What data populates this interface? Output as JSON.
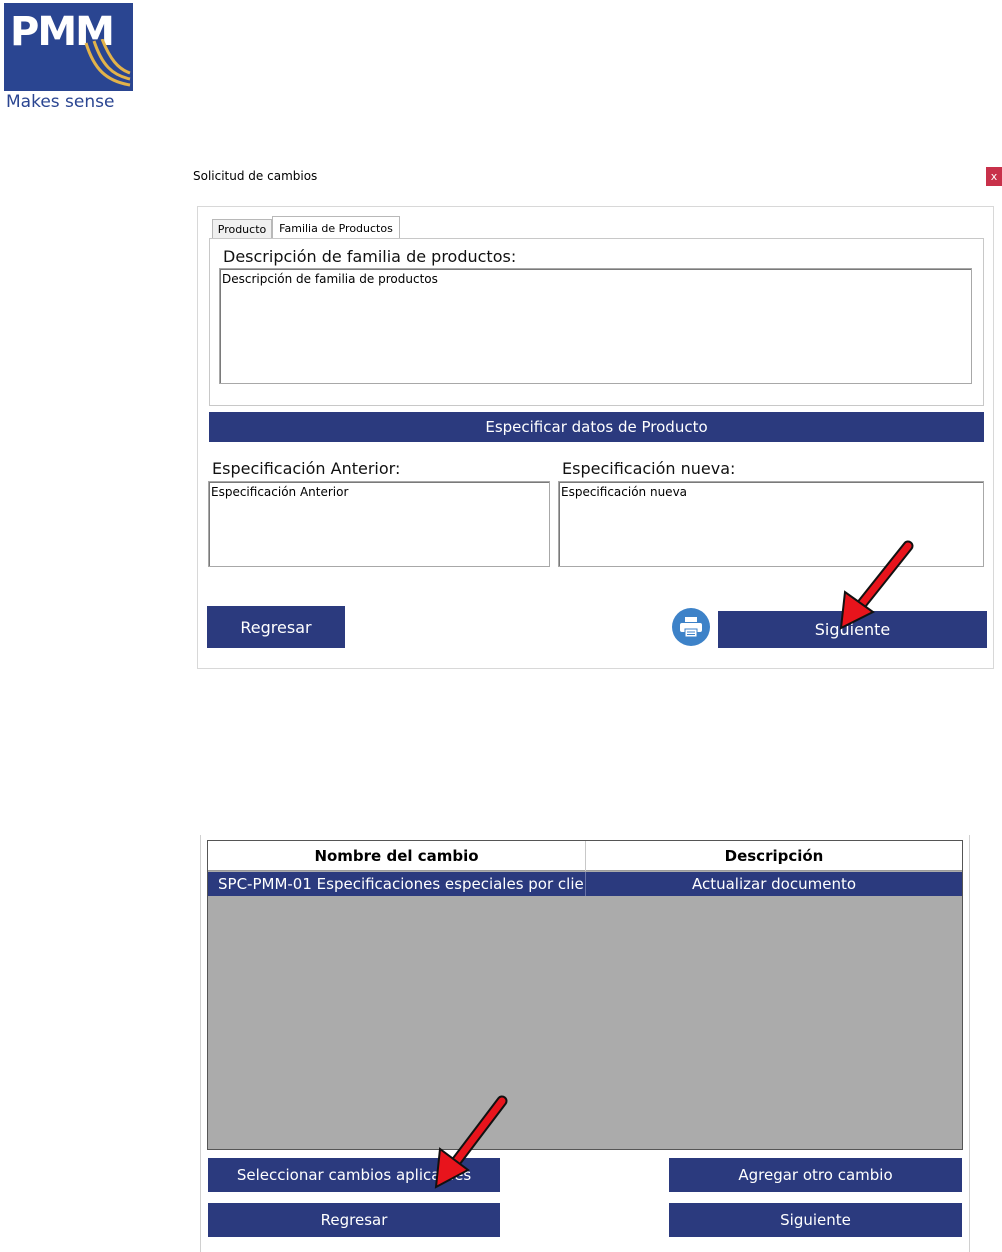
{
  "logo": {
    "brand": "PMM",
    "tagline": "Makes sense"
  },
  "dialog": {
    "title": "Solicitud de cambios",
    "close_label": "x",
    "tabs": [
      {
        "label": "Producto"
      },
      {
        "label": "Familia de Productos"
      }
    ],
    "family_desc_label": "Descripción de familia de productos:",
    "family_desc_value": "Descripción de familia de productos",
    "spec_button_label": "Especificar datos de Producto",
    "prev_spec_label": "Especificación Anterior:",
    "prev_spec_value": "Especificación Anterior",
    "new_spec_label": "Especificación nueva:",
    "new_spec_value": "Especificación nueva",
    "back_button_label": "Regresar",
    "print_icon": "printer-icon",
    "next_button_label": "Siguiente"
  },
  "changes": {
    "columns": [
      "Nombre del cambio",
      "Descripción"
    ],
    "rows": [
      {
        "name": "SPC-PMM-01 Especificaciones especiales por clie...",
        "description": "Actualizar documento"
      }
    ],
    "select_button_label": "Seleccionar cambios aplicables",
    "add_button_label": "Agregar otro cambio",
    "back_button_label": "Regresar",
    "next_button_label": "Siguiente"
  },
  "colors": {
    "accent": "#2b3a7e",
    "annotation_arrow": "#e8141c",
    "close": "#c8314a",
    "grid_bg": "#ababab"
  }
}
